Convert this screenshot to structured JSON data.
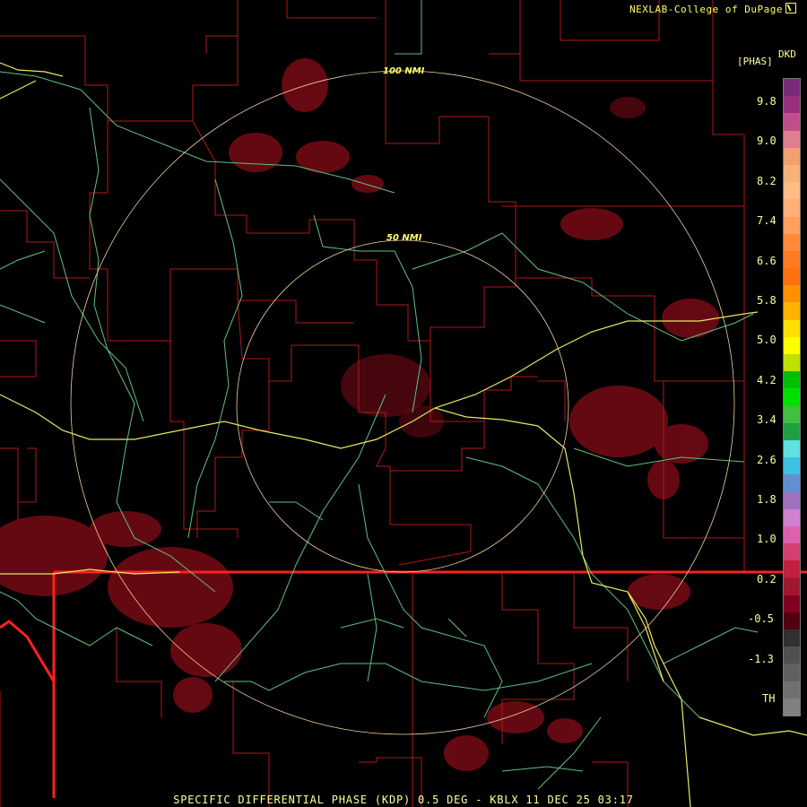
{
  "header": {
    "credit": "NEXLAB-College of DuPage",
    "product_code": "DKD",
    "units": "[PHAS]"
  },
  "range_rings": [
    {
      "label": "100 NMI"
    },
    {
      "label": "50 NMI"
    }
  ],
  "legend": {
    "ticks": [
      "9.8",
      "9.0",
      "8.2",
      "7.4",
      "6.6",
      "5.8",
      "5.0",
      "4.2",
      "3.4",
      "2.6",
      "1.8",
      "1.0",
      "0.2",
      "-0.5",
      "-1.3",
      "TH"
    ],
    "colors": [
      "#7a2a7a",
      "#9a2f80",
      "#c04e8a",
      "#e07e8e",
      "#f2a070",
      "#f7b27a",
      "#ffbc88",
      "#ffb07a",
      "#ffa060",
      "#ff8a3a",
      "#ff7a20",
      "#ff7010",
      "#ff9000",
      "#ffb400",
      "#ffe000",
      "#ffff00",
      "#c0e000",
      "#00c000",
      "#00e000",
      "#40c040",
      "#20a040",
      "#60e0e0",
      "#40c0e0",
      "#6090d0",
      "#a070c0",
      "#d080d0",
      "#e060b0",
      "#d04070",
      "#c02040",
      "#a01830",
      "#800020",
      "#500010",
      "#303030",
      "#505050",
      "#606060",
      "#707070",
      "#808080"
    ]
  },
  "footer": {
    "title": "SPECIFIC DIFFERENTIAL PHASE (KDP) 0.5 DEG - KBLX 11 DEC 25 03:17"
  },
  "colors": {
    "background": "#000000",
    "county_lines": "#b01818",
    "state_line": "#ff2020",
    "rivers": "#60c080",
    "highway": "#e8e860",
    "rings": "#f0d0a0",
    "echo": "#6a0a14"
  }
}
